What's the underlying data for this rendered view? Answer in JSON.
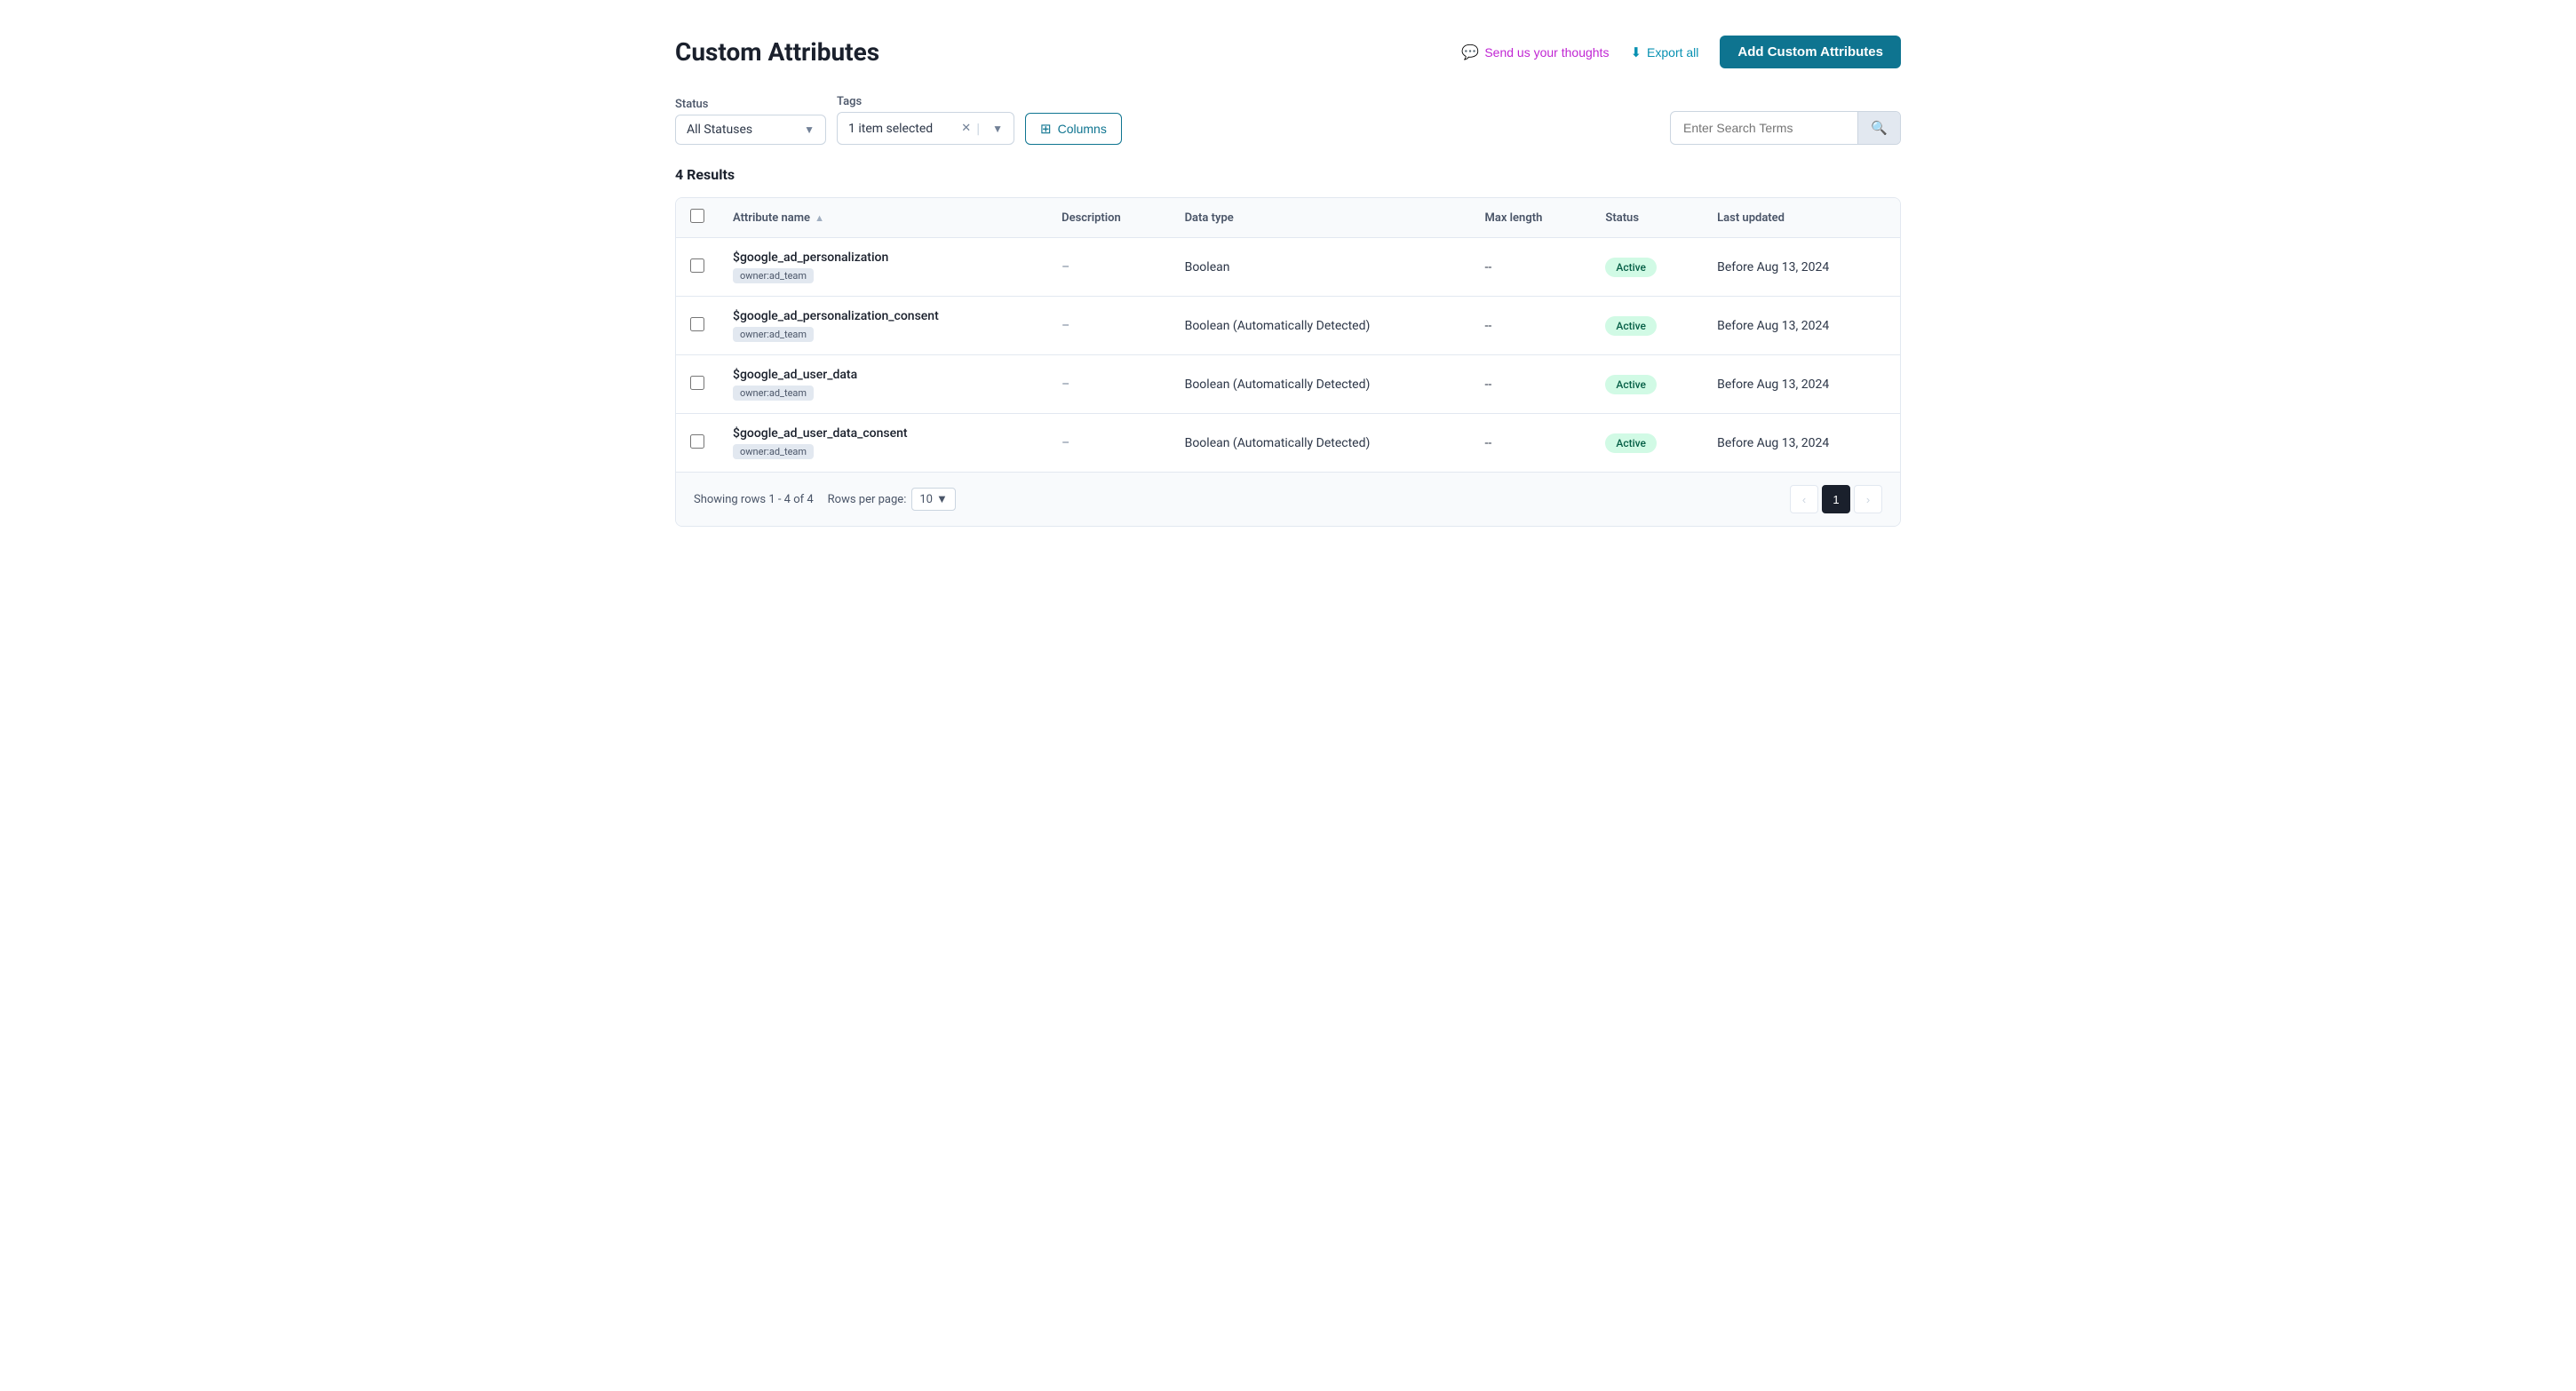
{
  "page": {
    "title": "Custom Attributes"
  },
  "header": {
    "send_thoughts_label": "Send us your thoughts",
    "export_label": "Export all",
    "add_btn_label": "Add Custom Attributes"
  },
  "filters": {
    "status_label": "Status",
    "status_value": "All Statuses",
    "tags_label": "Tags",
    "tags_value": "1 item selected",
    "columns_label": "Columns",
    "search_placeholder": "Enter Search Terms"
  },
  "results": {
    "count_label": "4 Results"
  },
  "table": {
    "columns": [
      {
        "id": "attr_name",
        "label": "Attribute name",
        "sortable": true
      },
      {
        "id": "description",
        "label": "Description",
        "sortable": false
      },
      {
        "id": "data_type",
        "label": "Data type",
        "sortable": false
      },
      {
        "id": "max_length",
        "label": "Max length",
        "sortable": false
      },
      {
        "id": "status",
        "label": "Status",
        "sortable": false
      },
      {
        "id": "last_updated",
        "label": "Last updated",
        "sortable": false
      }
    ],
    "rows": [
      {
        "attr_name": "$google_ad_personalization",
        "tag": "owner:ad_team",
        "description": "–",
        "data_type": "Boolean",
        "max_length": "--",
        "status": "Active",
        "last_updated": "Before Aug 13, 2024"
      },
      {
        "attr_name": "$google_ad_personalization_consent",
        "tag": "owner:ad_team",
        "description": "–",
        "data_type": "Boolean (Automatically Detected)",
        "max_length": "--",
        "status": "Active",
        "last_updated": "Before Aug 13, 2024"
      },
      {
        "attr_name": "$google_ad_user_data",
        "tag": "owner:ad_team",
        "description": "–",
        "data_type": "Boolean (Automatically Detected)",
        "max_length": "--",
        "status": "Active",
        "last_updated": "Before Aug 13, 2024"
      },
      {
        "attr_name": "$google_ad_user_data_consent",
        "tag": "owner:ad_team",
        "description": "–",
        "data_type": "Boolean (Automatically Detected)",
        "max_length": "--",
        "status": "Active",
        "last_updated": "Before Aug 13, 2024"
      }
    ]
  },
  "footer": {
    "showing_text": "Showing rows 1 - 4 of 4",
    "rows_per_page_label": "Rows per page:",
    "rows_per_page_value": "10",
    "current_page": "1"
  }
}
